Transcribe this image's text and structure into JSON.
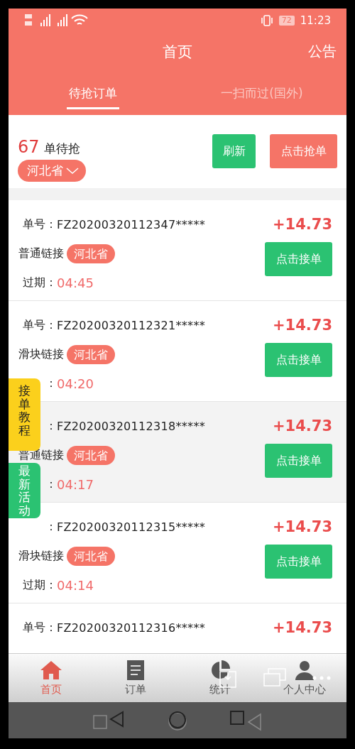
{
  "status_bar": {
    "battery": "72",
    "time": "11:23"
  },
  "header": {
    "title": "首页",
    "action": "公告"
  },
  "tabs": [
    {
      "label": "待抢订单",
      "selected": true
    },
    {
      "label": "一扫而过(国外)",
      "selected": false
    }
  ],
  "summary": {
    "count": "67",
    "count_label": "单待抢",
    "region": "河北省",
    "buttons": [
      {
        "label": "刷新",
        "kind": "refresh"
      },
      {
        "label": "点击抢单",
        "kind": "grab"
      }
    ]
  },
  "orders": [
    {
      "number_label": "单号：",
      "number": "FZ20200320112347*****",
      "amount": "+14.73",
      "link_type": "普通链接",
      "region": "河北省",
      "expiry_label": "过期：",
      "expiry": "04:45",
      "button": "点击接单",
      "shaded": false
    },
    {
      "number_label": "单号：",
      "number": "FZ20200320112321*****",
      "amount": "+14.73",
      "link_type": "滑块链接",
      "region": "河北省",
      "expiry_label": "：",
      "expiry": "04:20",
      "button": "点击接单",
      "shaded": false
    },
    {
      "number_label": "：",
      "number": "FZ20200320112318*****",
      "amount": "+14.73",
      "link_type": "普通链接",
      "region": "河北省",
      "expiry_label": "：",
      "expiry": "04:17",
      "button": "点击接单",
      "shaded": true
    },
    {
      "number_label": "：",
      "number": "FZ20200320112315*****",
      "amount": "+14.73",
      "link_type": "滑块链接",
      "region": "河北省",
      "expiry_label": "过期：",
      "expiry": "04:14",
      "button": "点击接单",
      "shaded": false
    },
    {
      "number_label": "单号：",
      "number": "FZ20200320112316*****",
      "amount": "+14.73",
      "shaded": false
    }
  ],
  "float_buttons": [
    {
      "label": "接单教程",
      "kind": "tutorial"
    },
    {
      "label": "最新活动",
      "kind": "events"
    }
  ],
  "bottom_nav": [
    {
      "label": "首页",
      "kind": "home",
      "selected": true
    },
    {
      "label": "订单",
      "kind": "orders",
      "selected": false
    },
    {
      "label": "统计",
      "kind": "stats",
      "selected": false
    },
    {
      "label": "个人中心",
      "kind": "profile",
      "selected": false
    }
  ]
}
